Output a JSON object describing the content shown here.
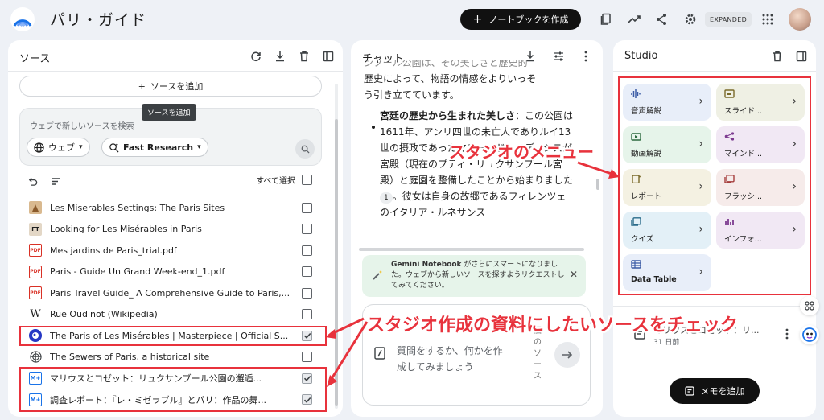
{
  "app": {
    "title": "パリ・ガイド"
  },
  "header": {
    "new_notebook_label": "ノートブックを作成",
    "expanded_label": "EXPANDED",
    "icons": [
      "notebook-copy-icon",
      "analytics-icon",
      "share-icon",
      "settings-icon",
      "apps-grid-icon"
    ]
  },
  "sources": {
    "title": "ソース",
    "add_source_label": "ソースを追加",
    "tooltip": "ソースを追加",
    "search_placeholder": "ウェブで新しいソースを検索",
    "web_chip": "ウェブ",
    "research_chip": "Fast Research",
    "select_all_label": "すべて選択",
    "items": [
      {
        "label": "Les Miserables Settings: The Paris Sites",
        "icon": "image-thumb",
        "checked": false
      },
      {
        "label": "Looking for Les Misérables in Paris",
        "icon": "ft-logo",
        "checked": false
      },
      {
        "label": "Mes jardins de Paris_trial.pdf",
        "icon": "pdf",
        "checked": false
      },
      {
        "label": "Paris - Guide Un Grand Week-end_1.pdf",
        "icon": "pdf",
        "checked": false
      },
      {
        "label": "Paris Travel Guide_ A Comprehensive Guide to Paris,...",
        "icon": "pdf",
        "checked": false
      },
      {
        "label": "Rue Oudinot (Wikipedia)",
        "icon": "wikipedia",
        "checked": false
      },
      {
        "label": "The Paris of Les Misérables | Masterpiece | Official S...",
        "icon": "pbs",
        "checked": true
      },
      {
        "label": "The Sewers of Paris, a historical site",
        "icon": "web",
        "checked": false
      },
      {
        "label": "マリウスとコゼット：リュクサンブール公園の邂逅...",
        "icon": "note",
        "checked": true
      },
      {
        "label": "調査レポート：『レ・ミゼラブル』とパリ：作品の舞...",
        "icon": "note",
        "checked": true
      }
    ],
    "pdf_badge": "PDF",
    "note_badge": "M+",
    "ft_badge": "FT",
    "wiki_badge": "W"
  },
  "annotations": {
    "studio_menu": "スタジオのメニュー",
    "check_sources": "スタジオ作成の資料にしたいソースをチェック"
  },
  "chat": {
    "title": "チャット",
    "body_faded_1": "ンブール公園は、その美しさと歴史的",
    "body_line_2": "歴史によって、物語の情感をよりいっそ",
    "body_line_3": "う引き立てています。",
    "bullet_bold": "宮廷の歴史から生まれた美しさ",
    "bullet_text": "：この公園は1611年、アンリ四世の未亡人でありルイ13世の摂政であったマリー・ド・メディシスが宮殿（現在のプティ・リュクサンブール宮殿）と庭園を整備したことから始まりました",
    "citation": "1",
    "bullet_text_2": "。彼女は自身の故郷であるフィレンツェのイタリア・ルネサンス",
    "notice_bold": "Gemini Notebook",
    "notice_text": " がさらにスマートになりました。ウェブから新しいソースを探すようリクエストしてみてください。",
    "input_placeholder": "質問をするか、何かを作成してみましょう",
    "source_count": "個のソース"
  },
  "studio": {
    "title": "Studio",
    "tiles": [
      {
        "label": "音声解説",
        "icon": "audio-wave-icon",
        "bg": "#e8eef9",
        "fg": "#3b5ba5"
      },
      {
        "label": "スライド...",
        "icon": "slides-icon",
        "bg": "#eff0e4",
        "fg": "#7a6a2a"
      },
      {
        "label": "動画解説",
        "icon": "video-icon",
        "bg": "#e6f4ea",
        "fg": "#2d6a3f"
      },
      {
        "label": "マインド...",
        "icon": "mind-map-icon",
        "bg": "#f1e8f4",
        "fg": "#7c3a8f"
      },
      {
        "label": "レポート",
        "icon": "report-icon",
        "bg": "#f4f1e2",
        "fg": "#7a6a2a"
      },
      {
        "label": "フラッシ...",
        "icon": "flashcards-icon",
        "bg": "#f6ebea",
        "fg": "#a53d3d"
      },
      {
        "label": "クイズ",
        "icon": "quiz-icon",
        "bg": "#e3f0f7",
        "fg": "#2a6b8a"
      },
      {
        "label": "インフォ...",
        "icon": "infographic-icon",
        "bg": "#f1e8f4",
        "fg": "#7c3a8f"
      },
      {
        "label": "Data Table",
        "icon": "table-icon",
        "bg": "#e8eef9",
        "fg": "#3b5ba5"
      }
    ],
    "memo_title": "マリウスとコゼット：リ...",
    "memo_date": "31 日前",
    "add_memo_label": "メモを追加"
  }
}
